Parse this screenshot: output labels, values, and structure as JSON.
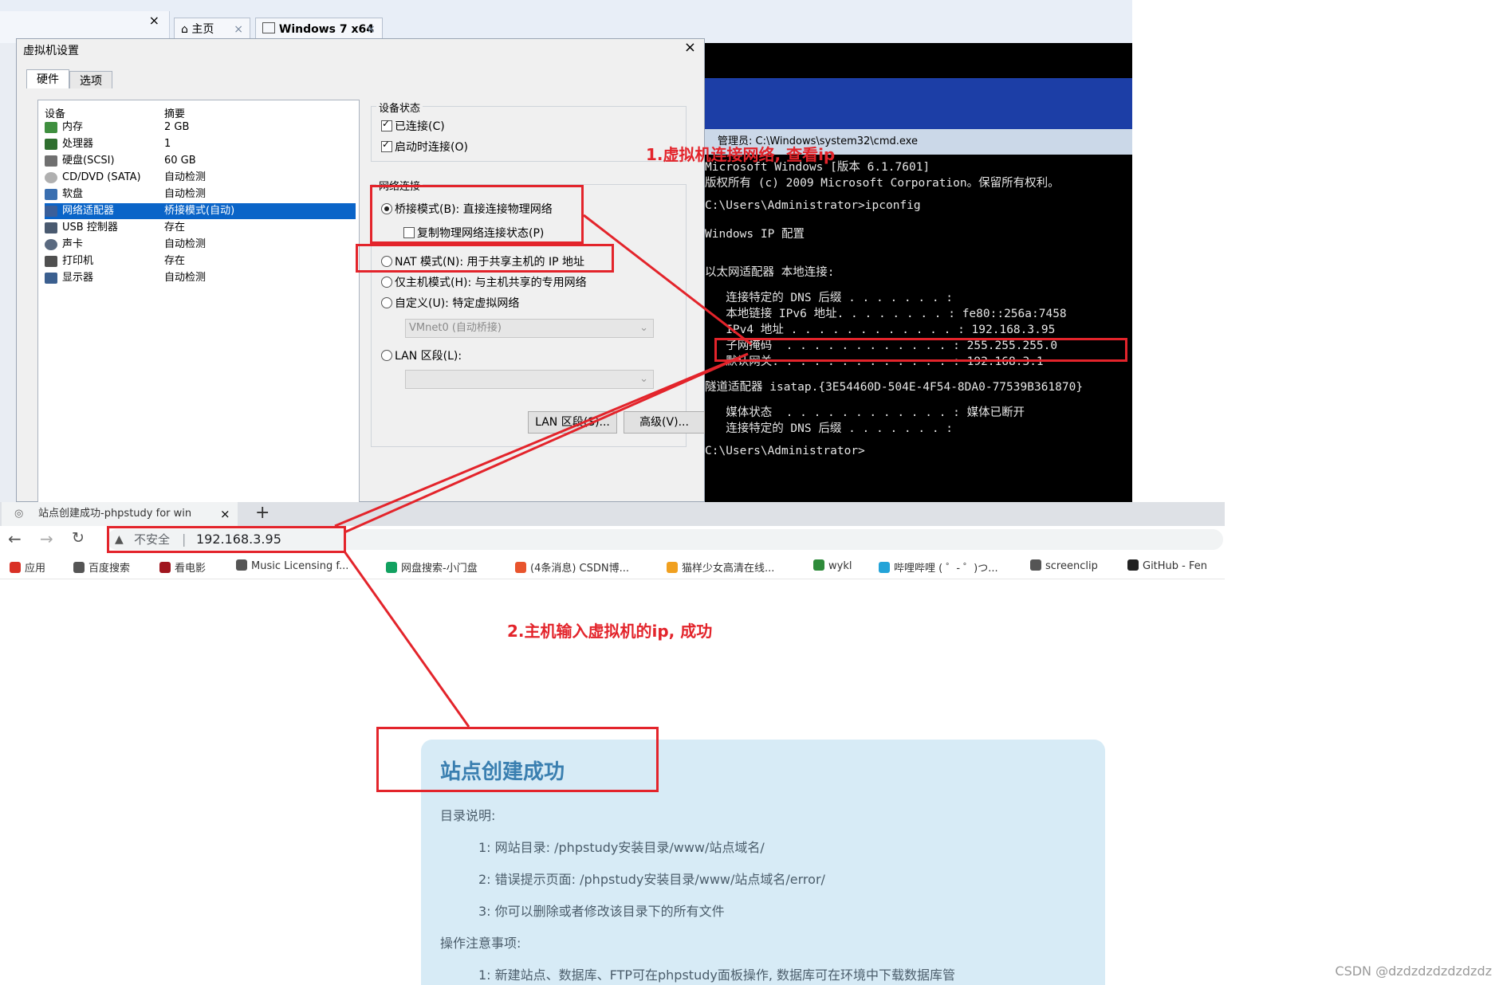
{
  "vmware": {
    "left_close": "×",
    "tabs": [
      {
        "label": "主页",
        "close": "×"
      },
      {
        "label": "Windows 7 x64",
        "close": "×"
      }
    ]
  },
  "dialog": {
    "title": "虚拟机设置",
    "close": "×",
    "tabs": [
      "硬件",
      "选项"
    ],
    "hardware": {
      "headers": [
        "设备",
        "摘要"
      ],
      "rows": [
        {
          "device": "内存",
          "summary": "2 GB"
        },
        {
          "device": "处理器",
          "summary": "1"
        },
        {
          "device": "硬盘(SCSI)",
          "summary": "60 GB"
        },
        {
          "device": "CD/DVD (SATA)",
          "summary": "自动检测"
        },
        {
          "device": "软盘",
          "summary": "自动检测"
        },
        {
          "device": "网络适配器",
          "summary": "桥接模式(自动)"
        },
        {
          "device": "USB 控制器",
          "summary": "存在"
        },
        {
          "device": "声卡",
          "summary": "自动检测"
        },
        {
          "device": "打印机",
          "summary": "存在"
        },
        {
          "device": "显示器",
          "summary": "自动检测"
        }
      ]
    },
    "device_status": {
      "label": "设备状态",
      "connected": "已连接(C)",
      "connect_on_power": "启动时连接(O)"
    },
    "network": {
      "label": "网络连接",
      "bridged": "桥接模式(B): 直接连接物理网络",
      "replicate": "复制物理网络连接状态(P)",
      "nat": "NAT 模式(N): 用于共享主机的 IP 地址",
      "host_only": "仅主机模式(H): 与主机共享的专用网络",
      "custom": "自定义(U): 特定虚拟网络",
      "custom_select": "VMnet0 (自动桥接)",
      "lan": "LAN 区段(L):",
      "lan_button": "LAN 区段(S)...",
      "advanced_button": "高级(V)..."
    }
  },
  "cmd": {
    "title": "管理员: C:\\Windows\\system32\\cmd.exe",
    "lines": [
      "Microsoft Windows [版本 6.1.7601]",
      "版权所有 (c) 2009 Microsoft Corporation。保留所有权利。",
      "",
      "C:\\Users\\Administrator>ipconfig",
      "",
      "Windows IP 配置",
      "",
      "",
      "以太网适配器 本地连接:",
      "",
      "   连接特定的 DNS 后缀 . . . . . . . :",
      "   本地链接 IPv6 地址. . . . . . . . : fe80::256a:7458",
      "   IPv4 地址 . . . . . . . . . . . . : 192.168.3.95",
      "   子网掩码  . . . . . . . . . . . . : 255.255.255.0",
      "   默认网关. . . . . . . . . . . . . : 192.168.3.1",
      "",
      "隧道适配器 isatap.{3E54460D-504E-4F54-8DA0-77539B361870}",
      "",
      "   媒体状态  . . . . . . . . . . . . : 媒体已断开",
      "   连接特定的 DNS 后缀 . . . . . . . :",
      "",
      "C:\\Users\\Administrator>"
    ]
  },
  "browser": {
    "tab_title": "站点创建成功-phpstudy for win",
    "tab_close": "×",
    "new_tab": "+",
    "security": "不安全",
    "separator": "|",
    "url": "192.168.3.95",
    "bookmarks": [
      {
        "label": "应用",
        "color": "#d93025"
      },
      {
        "label": "百度搜索",
        "color": "#555555"
      },
      {
        "label": "看电影",
        "color": "#a0151e"
      },
      {
        "label": "Music Licensing f...",
        "color": "#555555"
      },
      {
        "label": "网盘搜索-小门盘",
        "color": "#12a160"
      },
      {
        "label": "(4条消息) CSDN博...",
        "color": "#e8542d"
      },
      {
        "label": "猫样少女高清在线...",
        "color": "#f0a020"
      },
      {
        "label": "wykl",
        "color": "#2e8b3a"
      },
      {
        "label": "哔哩哔哩 ( ゜- ゜)つ...",
        "color": "#23a3d8"
      },
      {
        "label": "screenclip",
        "color": "#555555"
      },
      {
        "label": "GitHub - Fen",
        "color": "#222222"
      }
    ]
  },
  "page": {
    "title": "站点创建成功",
    "dir_heading": "目录说明:",
    "dir_items": [
      "1:  网站目录: /phpstudy安装目录/www/站点域名/",
      "2:  错误提示页面: /phpstudy安装目录/www/站点域名/error/",
      "3:  你可以删除或者修改该目录下的所有文件"
    ],
    "notes_heading": "操作注意事项:",
    "notes_items": [
      "1:  新建站点、数据库、FTP可在phpstudy面板操作, 数据库可在环境中下载数据库管"
    ]
  },
  "annotations": {
    "step1": "1.虚拟机连接网络, 查看ip",
    "step2": "2.主机输入虚拟机的ip, 成功",
    "color": "#e3242b"
  },
  "watermark": "CSDN @dzdzdzdzdzdzdz"
}
